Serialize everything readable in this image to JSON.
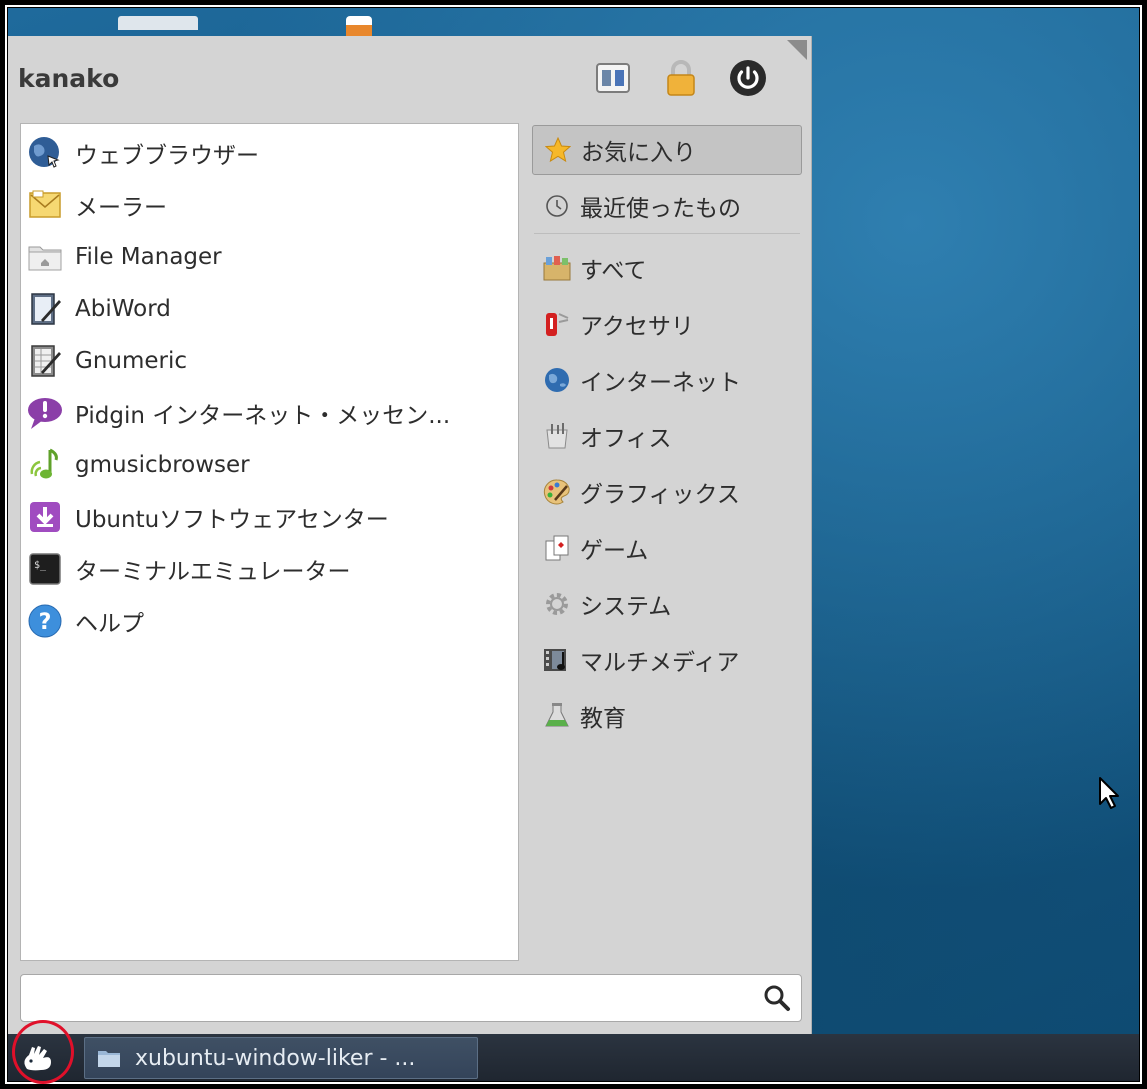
{
  "menu": {
    "username": "kanako",
    "header_buttons": [
      "switch-user-icon",
      "lock-icon",
      "power-icon"
    ],
    "apps": [
      {
        "label": "ウェブブラウザー",
        "icon": "web-browser-icon"
      },
      {
        "label": "メーラー",
        "icon": "mail-icon"
      },
      {
        "label": "File Manager",
        "icon": "file-manager-icon"
      },
      {
        "label": "AbiWord",
        "icon": "abiword-icon"
      },
      {
        "label": "Gnumeric",
        "icon": "gnumeric-icon"
      },
      {
        "label": "Pidgin インターネット・メッセン...",
        "icon": "pidgin-icon"
      },
      {
        "label": "gmusicbrowser",
        "icon": "music-icon"
      },
      {
        "label": "Ubuntuソフトウェアセンター",
        "icon": "software-center-icon"
      },
      {
        "label": "ターミナルエミュレーター",
        "icon": "terminal-icon"
      },
      {
        "label": "ヘルプ",
        "icon": "help-icon"
      }
    ],
    "categories": [
      {
        "label": "お気に入り",
        "icon": "star-icon",
        "active": true
      },
      {
        "label": "最近使ったもの",
        "icon": "clock-icon"
      },
      {
        "label": "すべて",
        "icon": "all-apps-icon"
      },
      {
        "label": "アクセサリ",
        "icon": "accessories-icon"
      },
      {
        "label": "インターネット",
        "icon": "globe-icon"
      },
      {
        "label": "オフィス",
        "icon": "office-icon"
      },
      {
        "label": "グラフィックス",
        "icon": "palette-icon"
      },
      {
        "label": "ゲーム",
        "icon": "games-icon"
      },
      {
        "label": "システム",
        "icon": "gear-icon"
      },
      {
        "label": "マルチメディア",
        "icon": "multimedia-icon"
      },
      {
        "label": "教育",
        "icon": "education-icon"
      }
    ],
    "search": {
      "value": "",
      "placeholder": ""
    }
  },
  "taskbar": {
    "start_icon": "xfce-mouse-icon",
    "task_label": "xubuntu-window-liker - ..."
  },
  "colors": {
    "desktop": "#1a6496",
    "menu_bg": "#d4d4d4",
    "taskbar_bg": "#252d38",
    "highlight_circle": "#e0102a"
  }
}
